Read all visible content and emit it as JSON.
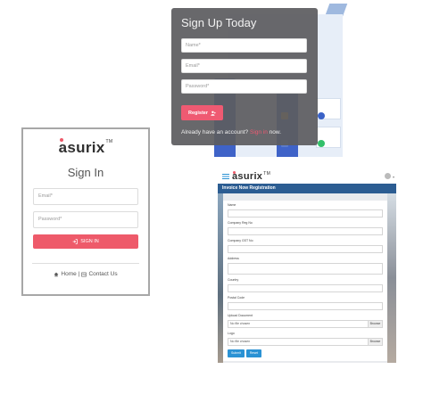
{
  "colors": {
    "accent": "#ee5a6a",
    "overlay": "#5c5c60",
    "header_blue": "#2c5d92",
    "button_blue": "#2a92d4"
  },
  "signup": {
    "title": "Sign Up Today",
    "name_placeholder": "Name*",
    "email_placeholder": "Email*",
    "password_placeholder": "Password*",
    "register_label": "Register",
    "register_icon": "user-plus-icon",
    "footer_text": "Already have an account?",
    "footer_link": "Sign in",
    "footer_suffix": "now."
  },
  "signin": {
    "logo_text": "asurix",
    "logo_tm": "TM",
    "title": "Sign In",
    "email_placeholder": "Email*",
    "password_placeholder": "Password*",
    "button_label": "SIGN IN",
    "button_icon": "sign-in-icon",
    "footer": {
      "home_label": "Home",
      "separator": "|",
      "contact_label": "Contact Us",
      "home_icon": "home-icon",
      "contact_icon": "contact-card-icon"
    }
  },
  "invoice": {
    "logo_text": "asurix",
    "logo_tm": "TM",
    "title": "Invoice Now Registration",
    "fields": [
      {
        "label": "Name",
        "type": "text"
      },
      {
        "label": "Company Reg No",
        "type": "text"
      },
      {
        "label": "Company GST No",
        "type": "text"
      },
      {
        "label": "Address",
        "type": "textarea"
      },
      {
        "label": "Country",
        "type": "text"
      },
      {
        "label": "Postal Code",
        "type": "text"
      }
    ],
    "files": [
      {
        "label": "Upload Document",
        "value": "No file chosen",
        "browse": "Browse"
      },
      {
        "label": "Logo",
        "value": "No file chosen",
        "browse": "Browse"
      }
    ],
    "submit_label": "Submit",
    "reset_label": "Reset"
  }
}
